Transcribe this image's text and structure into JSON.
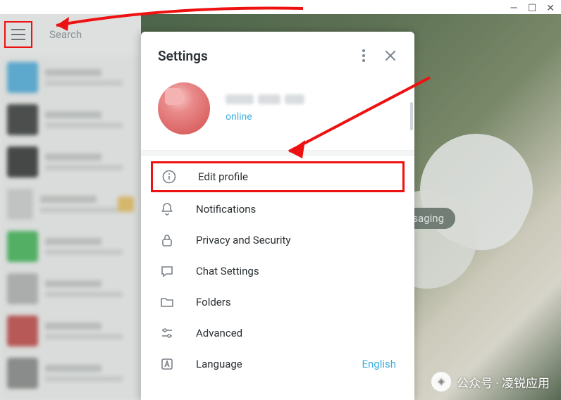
{
  "window": {
    "search_placeholder": "Search"
  },
  "background": {
    "badge_text": "ssaging"
  },
  "settings": {
    "title": "Settings",
    "profile": {
      "status": "online"
    },
    "items": [
      {
        "label": "Edit profile",
        "value": ""
      },
      {
        "label": "Notifications",
        "value": ""
      },
      {
        "label": "Privacy and Security",
        "value": ""
      },
      {
        "label": "Chat Settings",
        "value": ""
      },
      {
        "label": "Folders",
        "value": ""
      },
      {
        "label": "Advanced",
        "value": ""
      },
      {
        "label": "Language",
        "value": "English"
      }
    ]
  },
  "watermark": "公众号 · 凌锐应用"
}
